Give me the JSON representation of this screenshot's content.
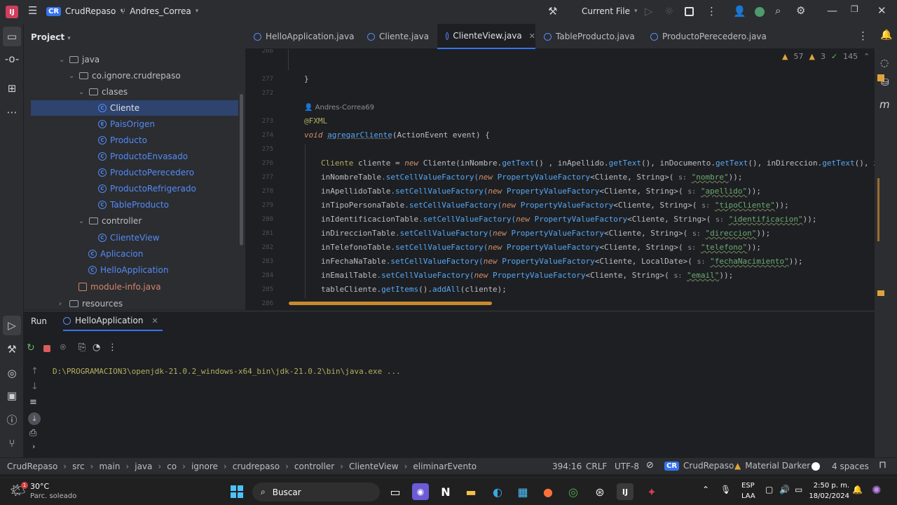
{
  "titlebar": {
    "project_badge": "CR",
    "project_name": "CrudRepaso",
    "branch": "Andres_Correa",
    "run_config": "Current File"
  },
  "project_panel": {
    "title": "Project",
    "items": [
      {
        "label": "java",
        "type": "folder"
      },
      {
        "label": "co.ignore.crudrepaso",
        "type": "package"
      },
      {
        "label": "clases",
        "type": "package"
      },
      {
        "label": "Cliente",
        "type": "class"
      },
      {
        "label": "PaisOrigen",
        "type": "enum"
      },
      {
        "label": "Producto",
        "type": "class"
      },
      {
        "label": "ProductoEnvasado",
        "type": "class"
      },
      {
        "label": "ProductoPerecedero",
        "type": "class"
      },
      {
        "label": "ProductoRefrigerado",
        "type": "class"
      },
      {
        "label": "TableProducto",
        "type": "class"
      },
      {
        "label": "controller",
        "type": "package"
      },
      {
        "label": "ClienteView",
        "type": "class"
      },
      {
        "label": "Aplicacion",
        "type": "class"
      },
      {
        "label": "HelloApplication",
        "type": "class"
      },
      {
        "label": "module-info.java",
        "type": "file"
      },
      {
        "label": "resources",
        "type": "folder"
      }
    ]
  },
  "tabs": [
    {
      "label": "HelloApplication.java"
    },
    {
      "label": "Cliente.java"
    },
    {
      "label": "ClienteView.java"
    },
    {
      "label": "TableProducto.java"
    },
    {
      "label": "ProductoPerecedero.java"
    }
  ],
  "inspections": {
    "warnings": "57",
    "weak": "3",
    "ok": "145"
  },
  "editor": {
    "line_numbers": [
      "266",
      "277",
      "272",
      "273",
      "274",
      "275",
      "276",
      "277",
      "278",
      "279",
      "280",
      "281",
      "282",
      "283",
      "284",
      "285",
      "286"
    ],
    "author_hint": "Andres-Correa69",
    "closing_brace": "}",
    "annotation": "@FXML",
    "method_kw": "void",
    "method_name": "agregarCliente",
    "method_params": "(ActionEvent event) {",
    "line_cliente": {
      "type": "Cliente",
      "rest1": " cliente = ",
      "new": "new",
      "rest2": " Cliente(inNombre.",
      "m1": "getText",
      "rest3": "() , inApellido.",
      "m2": "getText",
      "rest4": "(), inDocumento.",
      "m3": "getText",
      "rest5": "(), inDireccion.",
      "m4": "getText",
      "rest6": "(), inTelefono.g"
    },
    "factory_lines": [
      {
        "var": "inNombreTable",
        "gen": "<Cliente, String>(",
        "str": "\"nombre\""
      },
      {
        "var": "inApellidoTable",
        "gen": "<Cliente, String>(",
        "str": "\"apellido\""
      },
      {
        "var": "inTipoPersonaTable",
        "gen": "<Cliente, String>(",
        "str": "\"tipoCliente\""
      },
      {
        "var": "inIdentificacionTable",
        "gen": "<Cliente, String>(",
        "str": "\"identificacion\""
      },
      {
        "var": "inDireccionTable",
        "gen": "<Cliente, String>(",
        "str": "\"direccion\""
      },
      {
        "var": "inTelefonoTable",
        "gen": "<Cliente, String>(",
        "str": "\"telefono\""
      },
      {
        "var": "inFechaNaTable",
        "gen": "<Cliente, LocalDate>(",
        "str": "\"fechaNacimiento\""
      },
      {
        "var": "inEmailTable",
        "gen": "<Cliente, String>(",
        "str": "\"email\""
      }
    ],
    "set_factory": ".setCellValueFactory(",
    "new_kw": "new",
    "pvf": " PropertyValueFactory",
    "s_hint": "s:",
    "end": "));",
    "last_line": {
      "a": "tableCliente.",
      "m1": "getItems",
      "b": "().",
      "m2": "addAll",
      "c": "(cliente);"
    }
  },
  "run_panel": {
    "title": "Run",
    "tab": "HelloApplication",
    "output": "D:\\PROGRAMACION3\\openjdk-21.0.2_windows-x64_bin\\jdk-21.0.2\\bin\\java.exe ..."
  },
  "statusbar": {
    "crumbs": [
      "CrudRepaso",
      "src",
      "main",
      "java",
      "co",
      "ignore",
      "crudrepaso",
      "controller",
      "ClienteView",
      "eliminarEvento"
    ],
    "position": "394:16",
    "line_sep": "CRLF",
    "encoding": "UTF-8",
    "badge": "CR",
    "project": "CrudRepaso",
    "theme": "Material Darker",
    "indent": "4 spaces"
  },
  "taskbar": {
    "weather_temp": "30°C",
    "weather_desc": "Parc. soleado",
    "weather_badge": "1",
    "search": "Buscar",
    "lang1": "ESP",
    "lang2": "LAA",
    "time": "2:50 p. m.",
    "date": "18/02/2024"
  }
}
